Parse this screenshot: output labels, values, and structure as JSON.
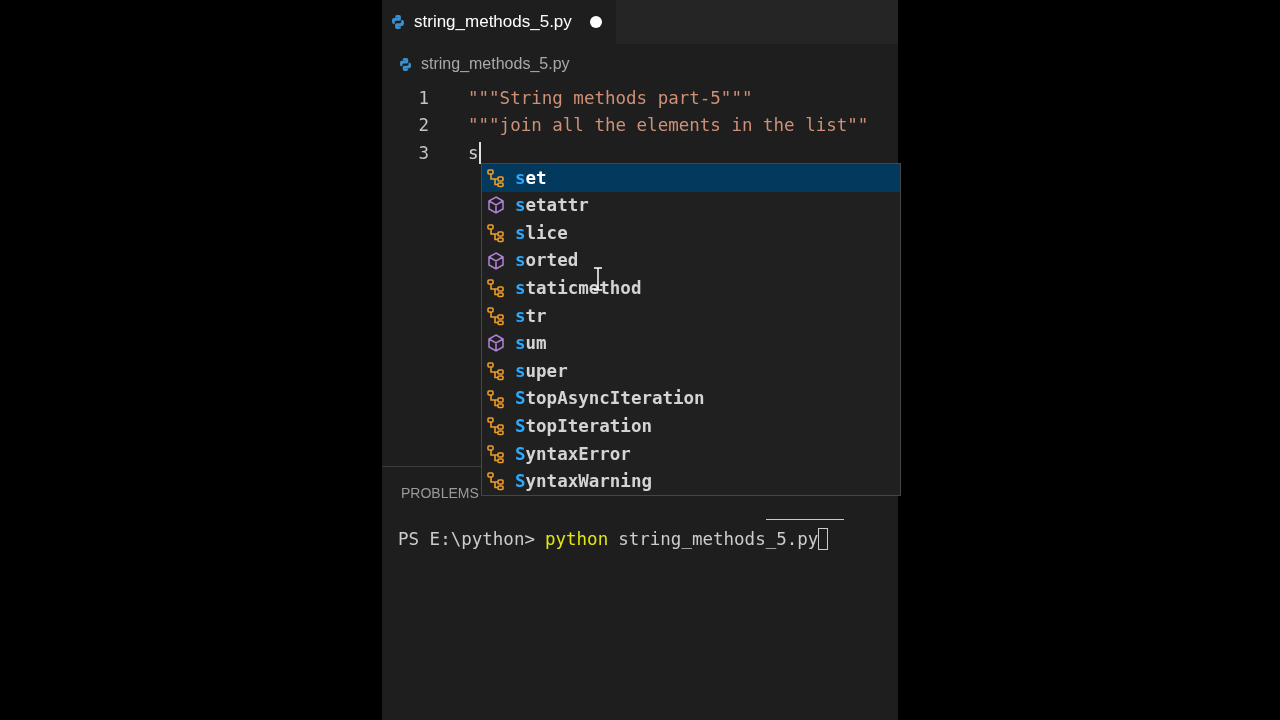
{
  "tab": {
    "title": "string_methods_5.py",
    "modified": true
  },
  "breadcrumb": "string_methods_5.py",
  "editor": {
    "lines": [
      {
        "number": "1",
        "text": "\"\"\"String methods part-5\"\"\"",
        "kind": "string"
      },
      {
        "number": "2",
        "text": "\"\"\"join all the elements in the list\"\"",
        "kind": "string"
      },
      {
        "number": "3",
        "text": "s",
        "kind": "plain"
      }
    ]
  },
  "suggestions": [
    {
      "label": "set",
      "kind": "class",
      "selected": true
    },
    {
      "label": "setattr",
      "kind": "function",
      "selected": false
    },
    {
      "label": "slice",
      "kind": "class",
      "selected": false
    },
    {
      "label": "sorted",
      "kind": "function",
      "selected": false
    },
    {
      "label": "staticmethod",
      "kind": "class",
      "selected": false
    },
    {
      "label": "str",
      "kind": "class",
      "selected": false
    },
    {
      "label": "sum",
      "kind": "function",
      "selected": false
    },
    {
      "label": "super",
      "kind": "class",
      "selected": false
    },
    {
      "label": "StopAsyncIteration",
      "kind": "class",
      "selected": false
    },
    {
      "label": "StopIteration",
      "kind": "class",
      "selected": false
    },
    {
      "label": "SyntaxError",
      "kind": "class",
      "selected": false
    },
    {
      "label": "SyntaxWarning",
      "kind": "class",
      "selected": false
    }
  ],
  "panel": {
    "tab": "PROBLEMS"
  },
  "terminal": {
    "prompt": "PS E:\\python>",
    "command": "python",
    "args": "string_methods_5.py"
  }
}
